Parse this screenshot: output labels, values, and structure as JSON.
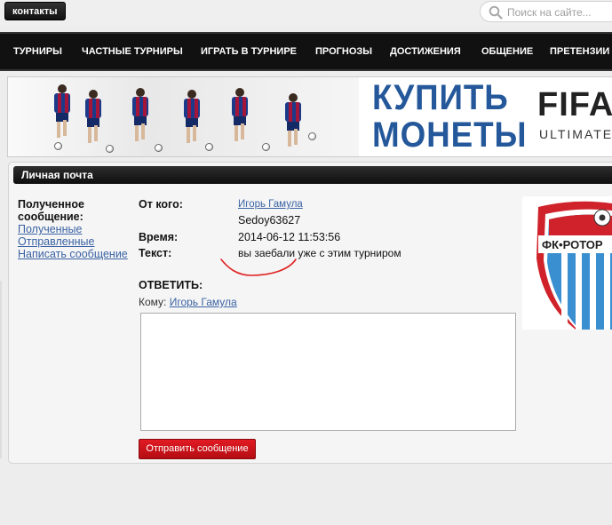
{
  "header": {
    "contacts_label": "контакты",
    "search_placeholder": "Поиск на сайте..."
  },
  "nav": {
    "items": [
      "ТУРНИРЫ",
      "ЧАСТНЫЕ ТУРНИРЫ",
      "ИГРАТЬ В ТУРНИРЕ",
      "ПРОГНОЗЫ",
      "ДОСТИЖЕНИЯ",
      "ОБЩЕНИЕ",
      "ПРЕТЕНЗИИ"
    ]
  },
  "banner": {
    "buy_line1": "КУПИТЬ",
    "buy_line2": "МОНЕТЫ",
    "brand": "FIFA",
    "brand_sub": "ULTIMATE"
  },
  "panel": {
    "title": "Личная почта"
  },
  "sidebar": {
    "title": "Полученное сообщение:",
    "links": [
      "Полученные",
      "Отправленные",
      "Написать сообщение"
    ]
  },
  "message": {
    "from_label": "От кого:",
    "from_name": "Игорь Гамула",
    "from_login": "Sedoy63627",
    "time_label": "Время:",
    "time_value": "2014-06-12 11:53:56",
    "text_label": "Текст:",
    "text_value": "вы заебали уже с этим турниром"
  },
  "reply": {
    "label": "ОТВЕТИТЬ:",
    "to_label": "Кому:",
    "to_name": "Игорь Гамула",
    "send_label": "Отправить сообщение"
  },
  "crest": {
    "text": "ФК•РОТОР"
  },
  "colors": {
    "link": "#3b63a4",
    "send_button": "#d0141b",
    "annotation": "#e02020",
    "banner_text": "#24589a"
  }
}
